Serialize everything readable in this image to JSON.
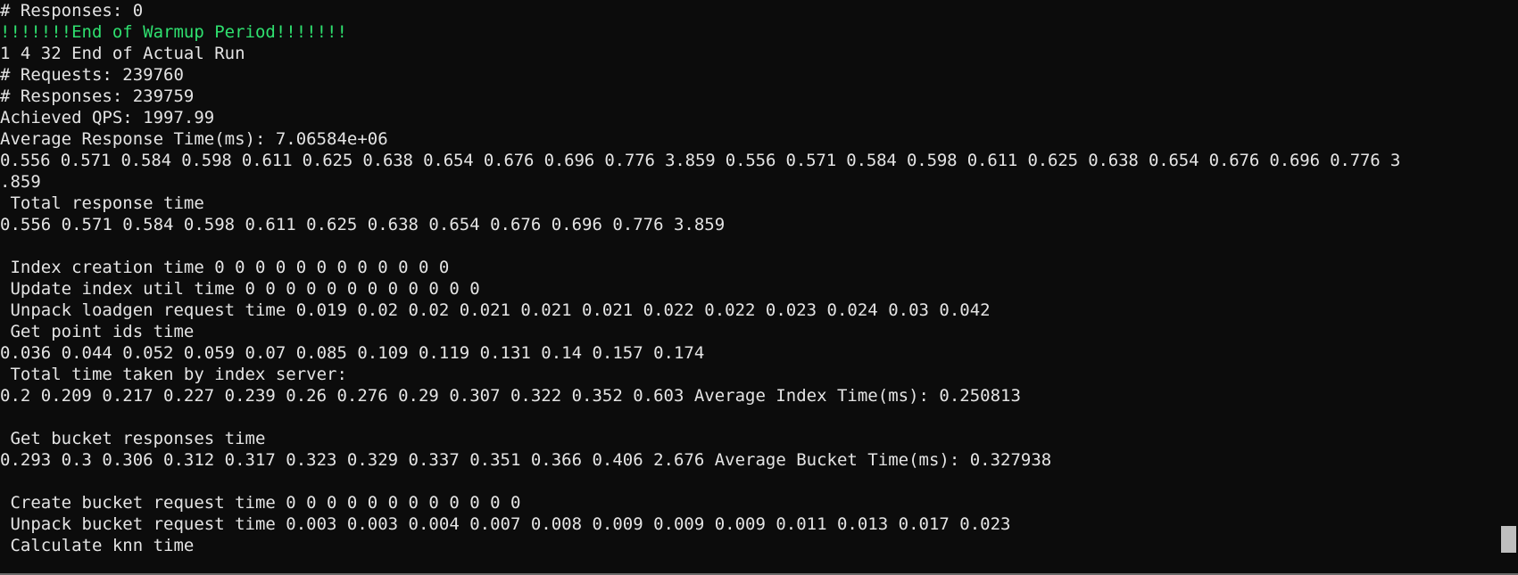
{
  "terminal": {
    "lines": [
      {
        "text": "# Responses: 0",
        "color": "#e4e4e4"
      },
      {
        "text": "!!!!!!!End of Warmup Period!!!!!!!",
        "color": "#2fe06f"
      },
      {
        "text": "1 4 32 End of Actual Run",
        "color": "#e4e4e4"
      },
      {
        "text": "# Requests: 239760",
        "color": "#e4e4e4"
      },
      {
        "text": "# Responses: 239759",
        "color": "#e4e4e4"
      },
      {
        "text": "Achieved QPS: 1997.99",
        "color": "#e4e4e4"
      },
      {
        "text": "Average Response Time(ms): 7.06584e+06",
        "color": "#e4e4e4"
      },
      {
        "text": "0.556 0.571 0.584 0.598 0.611 0.625 0.638 0.654 0.676 0.696 0.776 3.859 0.556 0.571 0.584 0.598 0.611 0.625 0.638 0.654 0.676 0.696 0.776 3",
        "color": "#e4e4e4"
      },
      {
        "text": ".859",
        "color": "#e4e4e4"
      },
      {
        "text": " Total response time",
        "color": "#e4e4e4"
      },
      {
        "text": "0.556 0.571 0.584 0.598 0.611 0.625 0.638 0.654 0.676 0.696 0.776 3.859",
        "color": "#e4e4e4"
      },
      {
        "text": "",
        "color": "#e4e4e4"
      },
      {
        "text": " Index creation time 0 0 0 0 0 0 0 0 0 0 0 0",
        "color": "#e4e4e4"
      },
      {
        "text": " Update index util time 0 0 0 0 0 0 0 0 0 0 0 0",
        "color": "#e4e4e4"
      },
      {
        "text": " Unpack loadgen request time 0.019 0.02 0.02 0.021 0.021 0.021 0.022 0.022 0.023 0.024 0.03 0.042",
        "color": "#e4e4e4"
      },
      {
        "text": " Get point ids time",
        "color": "#e4e4e4"
      },
      {
        "text": "0.036 0.044 0.052 0.059 0.07 0.085 0.109 0.119 0.131 0.14 0.157 0.174",
        "color": "#e4e4e4"
      },
      {
        "text": " Total time taken by index server:",
        "color": "#e4e4e4"
      },
      {
        "text": "0.2 0.209 0.217 0.227 0.239 0.26 0.276 0.29 0.307 0.322 0.352 0.603 Average Index Time(ms): 0.250813",
        "color": "#e4e4e4"
      },
      {
        "text": "",
        "color": "#e4e4e4"
      },
      {
        "text": " Get bucket responses time",
        "color": "#e4e4e4"
      },
      {
        "text": "0.293 0.3 0.306 0.312 0.317 0.323 0.329 0.337 0.351 0.366 0.406 2.676 Average Bucket Time(ms): 0.327938",
        "color": "#e4e4e4"
      },
      {
        "text": "",
        "color": "#e4e4e4"
      },
      {
        "text": " Create bucket request time 0 0 0 0 0 0 0 0 0 0 0 0",
        "color": "#e4e4e4"
      },
      {
        "text": " Unpack bucket request time 0.003 0.003 0.004 0.007 0.008 0.009 0.009 0.009 0.011 0.013 0.017 0.023",
        "color": "#e4e4e4"
      },
      {
        "text": " Calculate knn time",
        "color": "#e4e4e4"
      }
    ]
  },
  "scrollbar": {
    "scroll_position": 1.0
  },
  "colors": {
    "background": "#0c0c0c",
    "foreground": "#e4e4e4",
    "highlight": "#2fe06f",
    "scroll_thumb": "#bfbfbf"
  }
}
